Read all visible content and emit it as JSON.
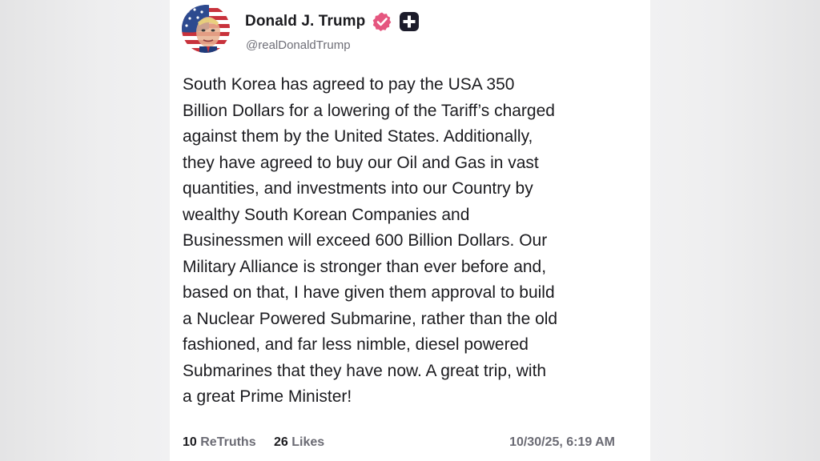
{
  "post": {
    "author": {
      "display_name": "Donald J. Trump",
      "handle": "@realDonaldTrump",
      "avatar_icon": "avatar-flag-portrait",
      "verified_icon": "verified-badge-icon",
      "verified_color": "#e5567f",
      "plus_icon": "plus-badge-icon"
    },
    "body": "South Korea has agreed to pay the USA 350\nBillion Dollars for a lowering of the Tariff’s charged\nagainst them by the United States. Additionally,\nthey have agreed to buy our Oil and Gas in vast\nquantities, and investments into our Country by\nwealthy South Korean Companies and\nBusinessmen will exceed 600 Billion Dollars. Our\nMilitary Alliance is stronger than ever before and,\nbased on that, I have given them approval to build\na Nuclear Powered Submarine, rather than the old\nfashioned, and far less nimble, diesel powered\nSubmarines that they have now. A great trip, with\na great Prime Minister!",
    "stats": {
      "retruths_count": "10",
      "retruths_label": "ReTruths",
      "likes_count": "26",
      "likes_label": "Likes"
    },
    "timestamp": "10/30/25, 6:19 AM"
  }
}
